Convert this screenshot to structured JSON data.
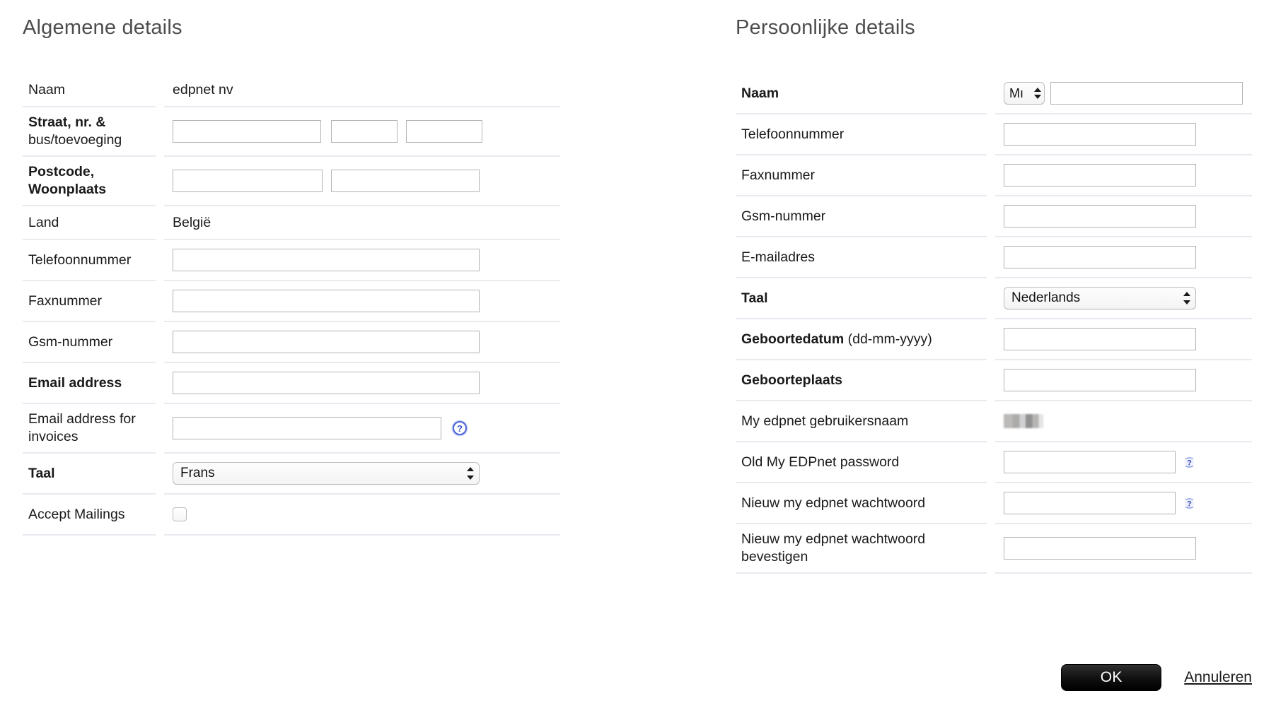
{
  "general": {
    "title": "Algemene details",
    "rows": {
      "name": {
        "label": "Naam",
        "value": "edpnet nv"
      },
      "street": {
        "label_line1": "Straat, nr.  &",
        "label_line2": "bus/toevoeging",
        "street_value": "",
        "number_value": "",
        "box_value": ""
      },
      "postcode": {
        "label_line1": "Postcode,",
        "label_line2": "Woonplaats",
        "zip_value": "",
        "city_value": ""
      },
      "country": {
        "label": "Land",
        "value": "België"
      },
      "phone": {
        "label": "Telefoonnummer",
        "value": ""
      },
      "fax": {
        "label": "Faxnummer",
        "value": ""
      },
      "mobile": {
        "label": "Gsm-nummer",
        "value": ""
      },
      "email": {
        "label": "Email address",
        "value": ""
      },
      "email_invoices": {
        "label_line1": "Email address for",
        "label_line2": "invoices",
        "value": "",
        "help_icon": "help-question-circle-icon"
      },
      "language": {
        "label": "Taal",
        "value": "Frans"
      },
      "mailings": {
        "label": "Accept Mailings",
        "checked": false
      }
    }
  },
  "personal": {
    "title": "Persoonlijke details",
    "rows": {
      "name": {
        "label": "Naam",
        "title_value": "Mı",
        "name_value": ""
      },
      "phone": {
        "label": "Telefoonnummer",
        "value": ""
      },
      "fax": {
        "label": "Faxnummer",
        "value": ""
      },
      "mobile": {
        "label": "Gsm-nummer",
        "value": ""
      },
      "email": {
        "label": "E-mailadres",
        "value": ""
      },
      "language": {
        "label": "Taal",
        "value": "Nederlands"
      },
      "birthdate": {
        "label_bold": "Geboortedatum",
        "label_normal": " (dd-mm-yyyy)",
        "value": ""
      },
      "birthplace": {
        "label": "Geboorteplaats",
        "value": ""
      },
      "username": {
        "label": "My edpnet gebruikersnaam",
        "value_redacted": true
      },
      "old_password": {
        "label": "Old My EDPnet password",
        "value": "",
        "help_icon": "help-question-icon"
      },
      "new_password": {
        "label": "Nieuw my edpnet wachtwoord",
        "value": "",
        "help_icon": "help-question-icon"
      },
      "confirm_password": {
        "label_line1": "Nieuw my edpnet wachtwoord",
        "label_line2": "bevestigen",
        "value": ""
      }
    }
  },
  "actions": {
    "ok_label": "OK",
    "cancel_label": "Annuleren"
  },
  "colors": {
    "help_blue": "#4a63d8",
    "rule": "#e7eaee",
    "input_border": "#b3b3b3",
    "heading": "#4d4d4d",
    "ok_button_bg": "#000000"
  }
}
